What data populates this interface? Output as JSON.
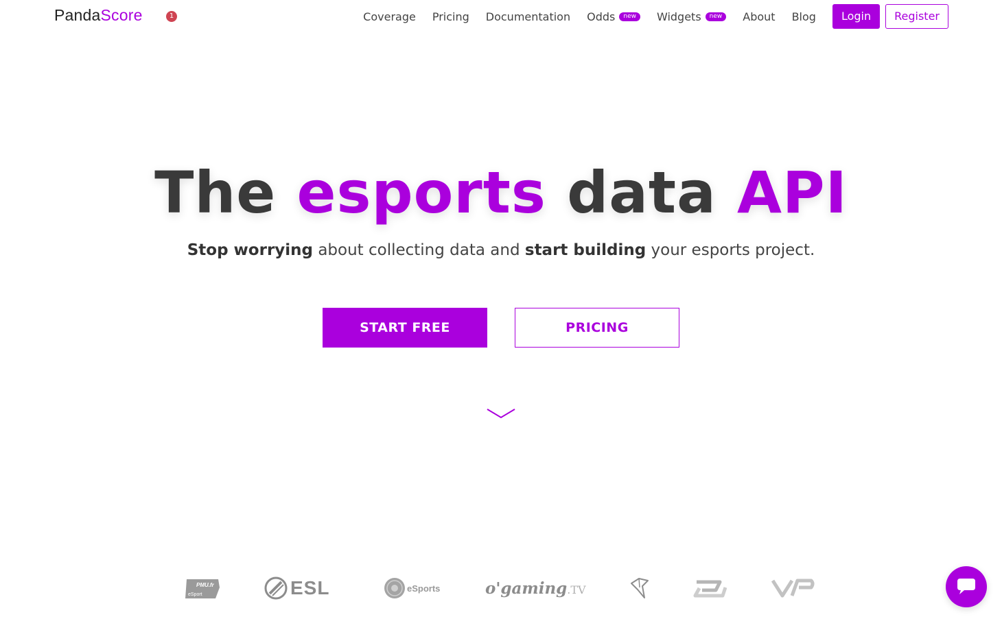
{
  "brand": {
    "part1": "Panda",
    "part2": "Score",
    "accent_color": "#aa00dd"
  },
  "notification": {
    "count": "1"
  },
  "nav": {
    "links": [
      {
        "label": "Coverage"
      },
      {
        "label": "Pricing"
      },
      {
        "label": "Documentation"
      },
      {
        "label": "Odds",
        "badge": "new"
      },
      {
        "label": "Widgets",
        "badge": "new"
      },
      {
        "label": "About"
      },
      {
        "label": "Blog"
      }
    ],
    "login_label": "Login",
    "register_label": "Register"
  },
  "hero": {
    "title_parts": [
      "The",
      "esports",
      "data",
      "API"
    ],
    "subtitle": {
      "bold1": "Stop worrying",
      "text1": "about collecting data and",
      "bold2": "start building",
      "text2": "your esports project."
    },
    "start_label": "START FREE",
    "pricing_label": "PRICING"
  },
  "partners": {
    "pmu": {
      "line1": "PMU.fr",
      "line2": "eSport"
    },
    "esl": "ESL",
    "psg": "eSports",
    "ogaming": {
      "main": "o'gaming",
      "suffix": ".TV"
    }
  },
  "icons": {
    "scroll": "chevron-down-icon",
    "chat": "chat-icon"
  }
}
